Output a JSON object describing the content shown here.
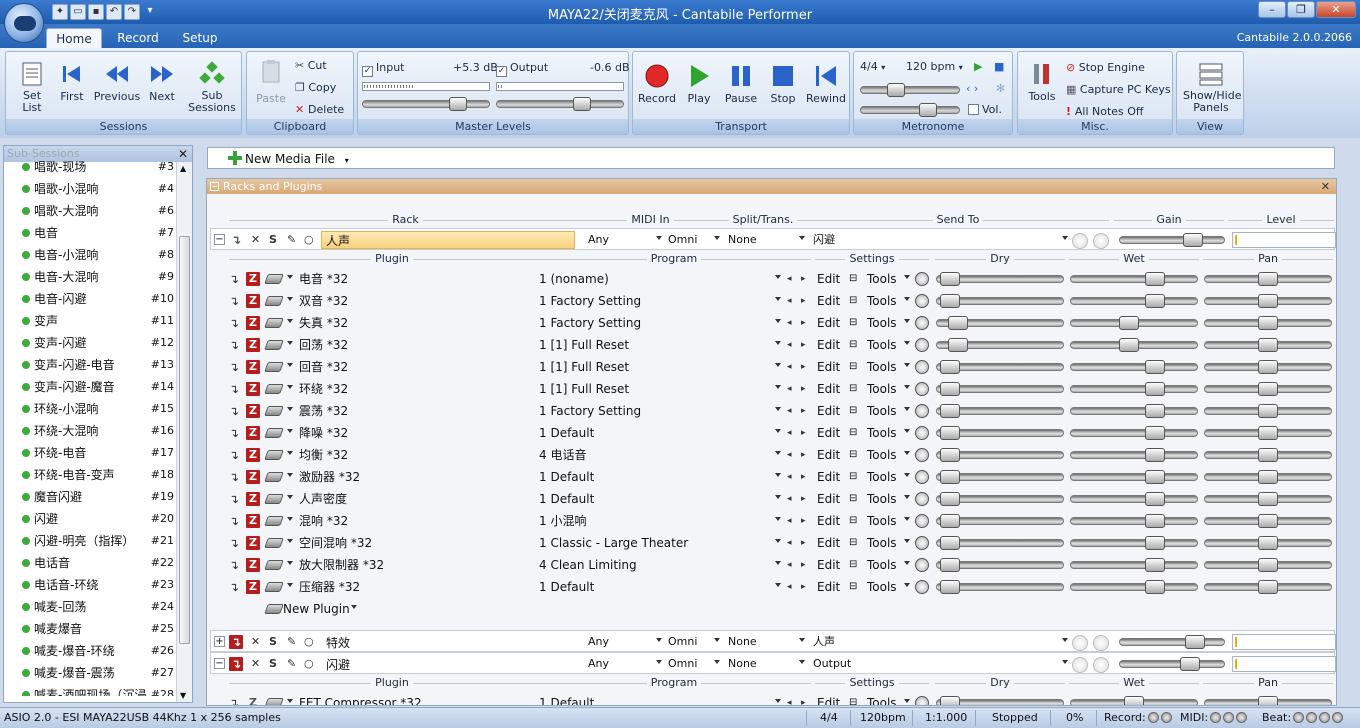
{
  "window": {
    "title": "MAYA22/关闭麦克风 - Cantabile Performer",
    "version": "Cantabile 2.0.0.2066"
  },
  "tabs": [
    "Home",
    "Record",
    "Setup"
  ],
  "ribbon": {
    "sessions": {
      "label": "Sessions",
      "set_list": "Set List",
      "first": "First",
      "previous": "Previous",
      "next": "Next",
      "sub_sessions": "Sub Sessions"
    },
    "clipboard": {
      "label": "Clipboard",
      "paste": "Paste",
      "cut": "Cut",
      "copy": "Copy",
      "delete": "Delete"
    },
    "master_levels": {
      "label": "Master Levels",
      "input_label": "Input",
      "input_db": "+5.3 dB",
      "output_label": "Output",
      "output_db": "-0.6 dB"
    },
    "transport": {
      "label": "Transport",
      "record": "Record",
      "play": "Play",
      "pause": "Pause",
      "stop": "Stop",
      "rewind": "Rewind"
    },
    "metronome": {
      "label": "Metronome",
      "time_sig": "4/4",
      "bpm": "120 bpm",
      "vol": "Vol."
    },
    "misc": {
      "label": "Misc.",
      "tools": "Tools",
      "stop_engine": "Stop Engine",
      "capture_keys": "Capture PC Keys",
      "all_notes_off": "All Notes Off"
    },
    "view": {
      "label": "View",
      "show_hide": "Show/Hide Panels"
    }
  },
  "sub_sessions": {
    "title": "Sub-Sessions",
    "items": [
      {
        "name": "唱歌-现场",
        "num": "#3"
      },
      {
        "name": "唱歌-小混响",
        "num": "#4"
      },
      {
        "name": "唱歌-大混响",
        "num": "#6"
      },
      {
        "name": "电音",
        "num": "#7"
      },
      {
        "name": "电音-小混响",
        "num": "#8"
      },
      {
        "name": "电音-大混响",
        "num": "#9"
      },
      {
        "name": "电音-闪避",
        "num": "#10"
      },
      {
        "name": "变声",
        "num": "#11"
      },
      {
        "name": "变声-闪避",
        "num": "#12"
      },
      {
        "name": "变声-闪避-电音",
        "num": "#13"
      },
      {
        "name": "变声-闪避-魔音",
        "num": "#14"
      },
      {
        "name": "环绕-小混响",
        "num": "#15"
      },
      {
        "name": "环绕-大混响",
        "num": "#16"
      },
      {
        "name": "环绕-电音",
        "num": "#17"
      },
      {
        "name": "环绕-电音-变声",
        "num": "#18"
      },
      {
        "name": "魔音闪避",
        "num": "#19"
      },
      {
        "name": "闪避",
        "num": "#20"
      },
      {
        "name": "闪避-明亮（指挥）",
        "num": "#21"
      },
      {
        "name": "电话音",
        "num": "#22"
      },
      {
        "name": "电话音-环绕",
        "num": "#23"
      },
      {
        "name": "喊麦-回荡",
        "num": "#24"
      },
      {
        "name": "喊麦爆音",
        "num": "#25"
      },
      {
        "name": "喊麦-爆音-环绕",
        "num": "#26"
      },
      {
        "name": "喊麦-爆音-震荡",
        "num": "#27"
      },
      {
        "name": "喊麦-酒吧现场（沉浸",
        "num": "#28"
      }
    ]
  },
  "media": {
    "new_media_file": "New Media File"
  },
  "racks_panel": {
    "title": "Racks and Plugins",
    "headers": {
      "rack": "Rack",
      "midi_in": "MIDI In",
      "split": "Split/Trans.",
      "send_to": "Send To",
      "gain": "Gain",
      "level": "Level"
    },
    "plugin_headers": {
      "plugin": "Plugin",
      "program": "Program",
      "settings": "Settings",
      "dry": "Dry",
      "wet": "Wet",
      "pan": "Pan"
    },
    "edit": "Edit",
    "tools": "Tools",
    "new_plugin": "New Plugin",
    "racks": [
      {
        "name": "人声",
        "midi": "Any",
        "channel": "Omni",
        "split": "None",
        "send_to": "闪避",
        "expanded": true,
        "plugins": [
          {
            "name": "电音 *32",
            "program": "1 (noname)",
            "dry": 0.03,
            "wet": 0.7,
            "pan": 0.5
          },
          {
            "name": "双音 *32",
            "program": "1 Factory Setting",
            "dry": 0.03,
            "wet": 0.7,
            "pan": 0.5
          },
          {
            "name": "失真 *32",
            "program": "1 Factory Setting",
            "dry": 0.1,
            "wet": 0.45,
            "pan": 0.5
          },
          {
            "name": "回荡 *32",
            "program": "1 [1] Full Reset",
            "dry": 0.1,
            "wet": 0.45,
            "pan": 0.5
          },
          {
            "name": "回音 *32",
            "program": "1 [1] Full Reset",
            "dry": 0.03,
            "wet": 0.7,
            "pan": 0.5
          },
          {
            "name": "环绕 *32",
            "program": "1 [1] Full Reset",
            "dry": 0.03,
            "wet": 0.7,
            "pan": 0.5
          },
          {
            "name": "震荡 *32",
            "program": "1 Factory Setting",
            "dry": 0.03,
            "wet": 0.7,
            "pan": 0.5
          },
          {
            "name": "降噪 *32",
            "program": "1 Default",
            "dry": 0.03,
            "wet": 0.7,
            "pan": 0.5
          },
          {
            "name": "均衡 *32",
            "program": "4 电话音",
            "dry": 0.03,
            "wet": 0.7,
            "pan": 0.5
          },
          {
            "name": "激励器 *32",
            "program": "1 Default",
            "dry": 0.03,
            "wet": 0.7,
            "pan": 0.5
          },
          {
            "name": "人声密度",
            "program": "1 Default",
            "dry": 0.03,
            "wet": 0.7,
            "pan": 0.5
          },
          {
            "name": "混响 *32",
            "program": "1 小混响",
            "dry": 0.03,
            "wet": 0.7,
            "pan": 0.5
          },
          {
            "name": "空间混响 *32",
            "program": "1 Classic - Large Theater",
            "dry": 0.03,
            "wet": 0.7,
            "pan": 0.5
          },
          {
            "name": "放大限制器 *32",
            "program": "4 Clean Limiting",
            "dry": 0.03,
            "wet": 0.7,
            "pan": 0.5
          },
          {
            "name": "压缩器 *32",
            "program": "1 Default",
            "dry": 0.03,
            "wet": 0.7,
            "pan": 0.5
          }
        ]
      },
      {
        "name": "特效",
        "midi": "Any",
        "channel": "Omni",
        "split": "None",
        "send_to": "人声",
        "expanded": false,
        "plugins": []
      },
      {
        "name": "闪避",
        "midi": "Any",
        "channel": "Omni",
        "split": "None",
        "send_to": "Output",
        "expanded": true,
        "plugins": [
          {
            "name": "FET Compressor *32",
            "program": "1 Default",
            "dry": 0.03,
            "wet": 0.5,
            "pan": 0.5
          }
        ]
      }
    ]
  },
  "status": {
    "asio": "ASIO 2.0 - ESI MAYA22USB 44Khz 1 x 256 samples",
    "time_sig": "4/4",
    "bpm": "120bpm",
    "position": "1:1.000",
    "state": "Stopped",
    "cpu": "0%",
    "record": "Record:",
    "midi": "MIDI:",
    "beat": "Beat:"
  }
}
